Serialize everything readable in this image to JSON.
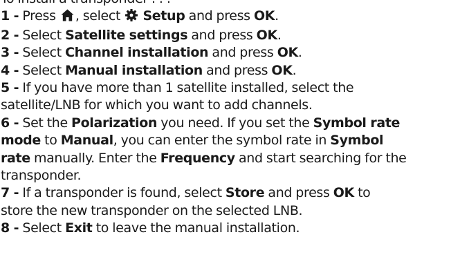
{
  "intro": "To install a transponder . . .",
  "steps": [
    {
      "num": "1 -",
      "l1": {
        "a": " Press ",
        "icon_home": "home-icon",
        "b": ", select ",
        "icon_setup": "gear-icon",
        "k1": "Setup",
        "c": " and press ",
        "k2": "OK",
        "d": "."
      }
    },
    {
      "num": "2 -",
      "l1": {
        "a": " Select ",
        "k1": "Satellite settings",
        "b": " and press ",
        "k2": "OK",
        "c": "."
      }
    },
    {
      "num": "3 -",
      "l1": {
        "a": " Select ",
        "k1": "Channel installation",
        "b": " and press ",
        "k2": "OK",
        "c": "."
      }
    },
    {
      "num": "4 -",
      "l1": {
        "a": " Select ",
        "k1": "Manual installation",
        "b": " and press ",
        "k2": "OK",
        "c": "."
      }
    },
    {
      "num": "5 -",
      "l1": {
        "a": " If you have more than 1 satellite installed, select the"
      },
      "l2": {
        "a": "satellite/LNB for which you want to add channels."
      }
    },
    {
      "num": "6 -",
      "l1": {
        "a": " Set the ",
        "k1": "Polarization",
        "b": " you need. If you set the ",
        "k2": "Symbol rate"
      },
      "l2": {
        "k1": "mode",
        "a": " to ",
        "k2": "Manual",
        "b": ", you can enter the symbol rate in ",
        "k3": "Symbol"
      },
      "l3": {
        "k1": "rate",
        "a": " manually. Enter the ",
        "k2": "Frequency",
        "b": " and start searching for the"
      },
      "l4": {
        "a": "transponder."
      }
    },
    {
      "num": "7 -",
      "l1": {
        "a": " If a transponder is found, select ",
        "k1": "Store",
        "b": " and press ",
        "k2": "OK",
        "c": " to"
      },
      "l2": {
        "a": "store the new transponder on the selected LNB."
      }
    },
    {
      "num": "8 -",
      "l1": {
        "a": " Select ",
        "k1": "Exit",
        "b": " to leave the manual installation."
      }
    }
  ]
}
